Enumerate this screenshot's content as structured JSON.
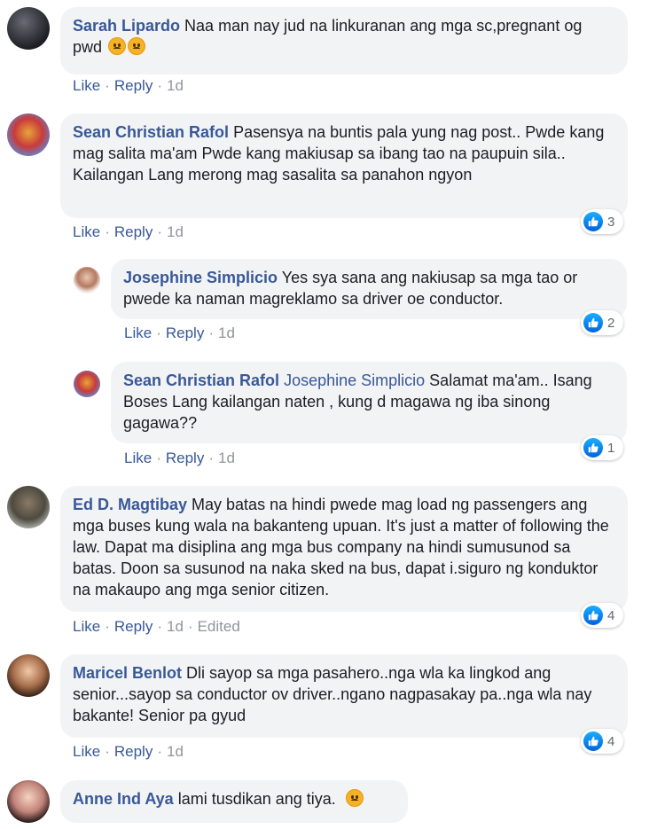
{
  "actions": {
    "like": "Like",
    "reply": "Reply",
    "sep": "·"
  },
  "colors": {
    "name": "#385898",
    "bubble": "#f2f3f5",
    "meta": "#90949c",
    "like_blue": "#1877f2"
  },
  "comments": [
    {
      "author": "Sarah Lipardo",
      "text": "Naa man nay jud na linkuranan ang mga sc,pregnant og pwd",
      "emoji": [
        "worried-face-emoji",
        "worried-face-emoji"
      ],
      "time": "1d",
      "avatar": "user-avatar-photo"
    },
    {
      "author": "Sean Christian Rafol",
      "text": "Pasensya na buntis pala yung nag post.. Pwde kang mag salita ma'am Pwde kang makiusap sa ibang tao na paupuin sila.. Kailangan Lang merong mag sasalita sa panahon ngyon",
      "time": "1d",
      "reactions": "3",
      "avatar": "user-avatar-photo"
    },
    {
      "author": "Josephine Simplicio",
      "text": "Yes sya sana ang nakiusap sa mga tao or pwede ka naman magreklamo sa driver oe conductor.",
      "time": "1d",
      "reactions": "2",
      "avatar": "user-avatar-photo"
    },
    {
      "author": "Sean Christian Rafol",
      "mention": "Josephine Simplicio",
      "text": "Salamat ma'am.. Isang Boses Lang kailangan naten , kung d magawa ng iba sinong gagawa??",
      "time": "1d",
      "reactions": "1",
      "avatar": "user-avatar-photo"
    },
    {
      "author": "Ed D. Magtibay",
      "text": "May batas na hindi pwede mag load ng passengers ang mga buses kung wala na bakanteng upuan. It's just a matter of following the law. Dapat ma disiplina ang mga bus company na hindi sumusunod sa batas. Doon sa susunod na naka sked na bus, dapat i.siguro ng konduktor na makaupo ang mga senior citizen.",
      "time": "1d",
      "edited": "Edited",
      "reactions": "4",
      "avatar": "user-avatar-photo"
    },
    {
      "author": "Maricel Benlot",
      "text": "Dli sayop sa mga pasahero..nga wla ka lingkod ang senior...sayop sa conductor ov driver..ngano nagpasakay pa..nga wla nay bakante! Senior pa gyud",
      "time": "1d",
      "reactions": "4",
      "avatar": "user-avatar-photo"
    },
    {
      "author": "Anne Ind Aya",
      "text": "lami tusdikan ang tiya.",
      "emoji": [
        "frowning-face-emoji"
      ],
      "avatar": "user-avatar-photo"
    }
  ]
}
